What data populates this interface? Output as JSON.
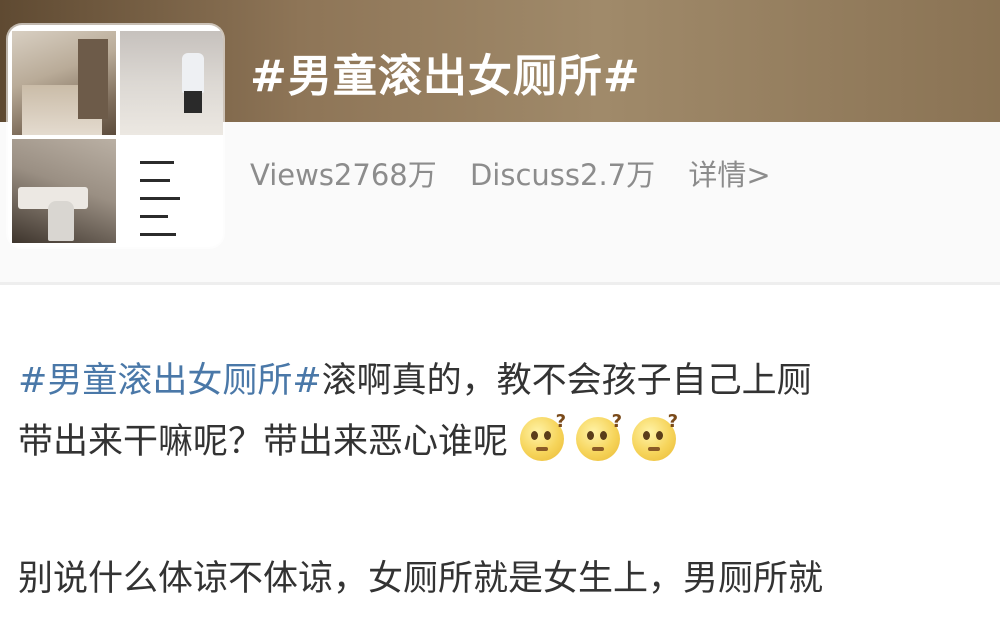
{
  "topic": {
    "title": "#男童滚出女厕所#"
  },
  "stats": {
    "views": "Views2768万",
    "discuss": "Discuss2.7万",
    "details_link": "详情>"
  },
  "post": {
    "hashtag": "#男童滚出女厕所#",
    "line1_text": "滚啊真的，教不会孩子自己上厕",
    "line2_text": "带出来干嘛呢？带出来恶心谁呢",
    "emojis": [
      "thinking-question-emoji",
      "thinking-question-emoji",
      "thinking-question-emoji"
    ],
    "line3_text": "别说什么体谅不体谅，女厕所就是女生上，男厕所就"
  },
  "colors": {
    "header_brown": "#8e7557",
    "hashtag_blue": "#4a78a8",
    "stats_gray": "#8c8c8c"
  }
}
